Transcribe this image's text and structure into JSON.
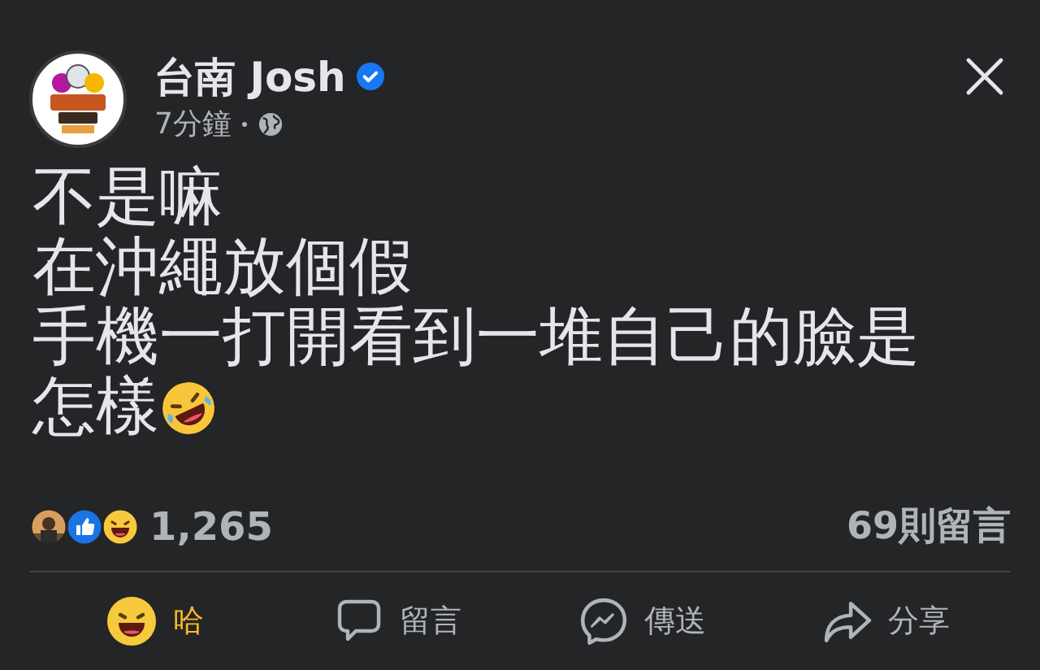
{
  "post": {
    "author": {
      "name": "台南 Josh",
      "verified": true
    },
    "time": "7分鐘",
    "lines": [
      {
        "text": "不是嘛",
        "emoji": false
      },
      {
        "text": "在沖繩放個假",
        "emoji": false
      },
      {
        "text": "手機一打開看到一堆自己的臉是",
        "emoji": false
      },
      {
        "text": "怎樣",
        "emoji": true
      }
    ]
  },
  "reactions": {
    "count": "1,265",
    "comments": "69則留言"
  },
  "actions": [
    {
      "kind": "react",
      "label": "哈",
      "selected": true
    },
    {
      "kind": "comment",
      "label": "留言",
      "selected": false
    },
    {
      "kind": "send",
      "label": "傳送",
      "selected": false
    },
    {
      "kind": "share",
      "label": "分享",
      "selected": false
    }
  ]
}
